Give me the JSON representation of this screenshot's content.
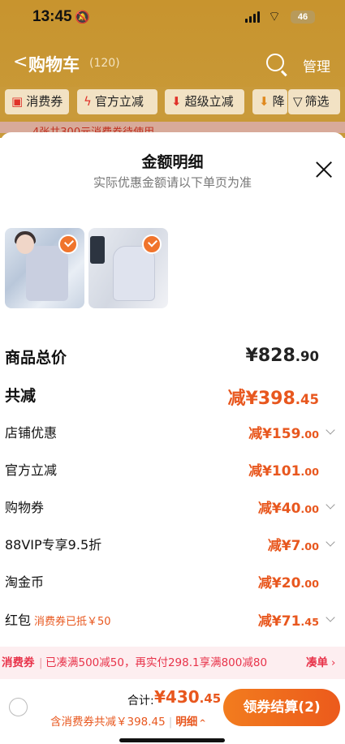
{
  "status": {
    "time": "13:45",
    "battery": "46"
  },
  "cart": {
    "title": "购物车",
    "count": "(120)",
    "manage": "管理"
  },
  "filters": [
    {
      "icon": "coupon-icon",
      "label": "消费券"
    },
    {
      "icon": "lightning-icon",
      "label": "官方立减"
    },
    {
      "icon": "down-arrow-icon",
      "label": "超级立减"
    },
    {
      "icon": "down-arrow-icon",
      "label": "降"
    },
    {
      "icon": "filter-icon",
      "label": "筛选"
    }
  ],
  "banner": "4张共300元消费券待使用",
  "sheet": {
    "title": "金额明细",
    "subtitle": "实际优惠金额请以下单页为准"
  },
  "summary": {
    "goods_label": "商品总价",
    "goods_value": "¥828",
    "goods_decimal": ".90",
    "total_discount_label": "共减",
    "total_discount_value": "减¥398",
    "total_discount_decimal": ".45"
  },
  "details": [
    {
      "label": "店铺优惠",
      "value": "减¥159",
      "decimal": ".00",
      "has_chevron": true
    },
    {
      "label": "官方立减",
      "value": "减¥101",
      "decimal": ".00",
      "has_chevron": false
    },
    {
      "label": "购物券",
      "value": "减¥40",
      "decimal": ".00",
      "has_chevron": true
    },
    {
      "label": "88VIP专享9.5折",
      "value": "减¥7",
      "decimal": ".00",
      "has_chevron": true
    },
    {
      "label": "淘金币",
      "value": "减¥20",
      "decimal": ".00",
      "has_chevron": false
    },
    {
      "label": "红包",
      "note": "消费券已抵￥50",
      "value": "减¥71",
      "decimal": ".45",
      "has_chevron": true
    }
  ],
  "promo": {
    "tag": "消费券",
    "text": "已凑满500减50，再实付298.1享满800减80",
    "action": "凑单"
  },
  "footer": {
    "total_label": "合计:",
    "total_value": "¥430",
    "total_decimal": ".45",
    "sub_text": "含消费券共减￥398.45",
    "detail_label": "明细",
    "checkout_label": "领券结算(2)"
  },
  "colors": {
    "accent": "#e8571e",
    "promo": "#e8334a",
    "header": "#c99a3a"
  }
}
